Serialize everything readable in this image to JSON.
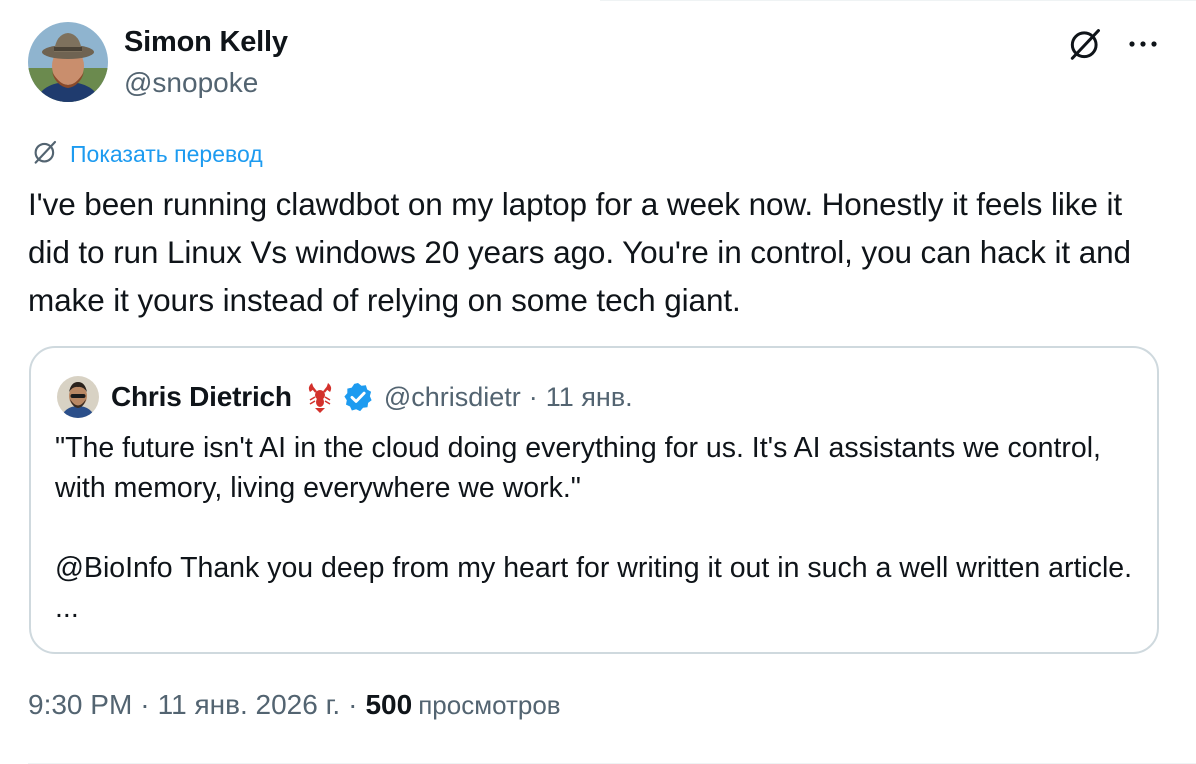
{
  "tweet": {
    "author": {
      "name": "Simon Kelly",
      "handle": "@snopoke",
      "avatar_icon": "avatar-photo"
    },
    "actions": {
      "grok_icon": "grok-icon",
      "more_icon": "more-dots-icon",
      "more_label": "···"
    },
    "translate": {
      "icon": "translate-grok-icon",
      "label": "Показать перевод",
      "color": "#1d9bf0"
    },
    "text": "I've been running clawdbot on my laptop for a week now. Honestly it feels like it did to run Linux Vs windows 20 years ago. You're in control, you can hack it and make it yours instead of relying on some tech giant.",
    "quote": {
      "name": "Chris Dietrich",
      "emoji_icon": "lobster-emoji-icon",
      "verified_icon": "verified-badge-icon",
      "verified_color": "#1d9bf0",
      "handle": "@chrisdietr",
      "separator": "·",
      "date": "11 янв.",
      "paragraph1": "\"The future isn't AI in the cloud doing everything for us. It's AI assistants we control, with memory, living everywhere we work.\"",
      "paragraph2": "@BioInfo Thank you deep from my heart for writing it out in such a well written article. ..."
    },
    "meta": {
      "time": "9:30 PM",
      "separator": "·",
      "date": "11 янв. 2026 г.",
      "views_count": "500",
      "views_label": "просмотров"
    }
  }
}
